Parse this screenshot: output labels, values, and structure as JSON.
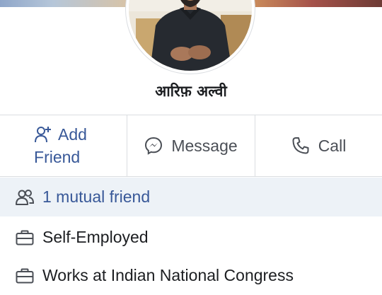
{
  "profile": {
    "name": "आरिफ़ अल्वी"
  },
  "actions": {
    "add_friend_line1": "Add",
    "add_friend_line2": "Friend",
    "message": "Message",
    "call": "Call"
  },
  "info": {
    "mutual": "1 mutual friend",
    "job1": "Self-Employed",
    "job2": "Works at Indian National Congress"
  },
  "icons": {
    "add_friend": "add-friend-icon",
    "message": "messenger-icon",
    "call": "phone-icon",
    "mutual": "people-icon",
    "job": "briefcase-icon"
  },
  "colors": {
    "accent": "#385898",
    "mutual_bg": "#edf2f7",
    "text": "#1c1e21",
    "muted": "#4b4f56",
    "divider": "#dadde1"
  }
}
